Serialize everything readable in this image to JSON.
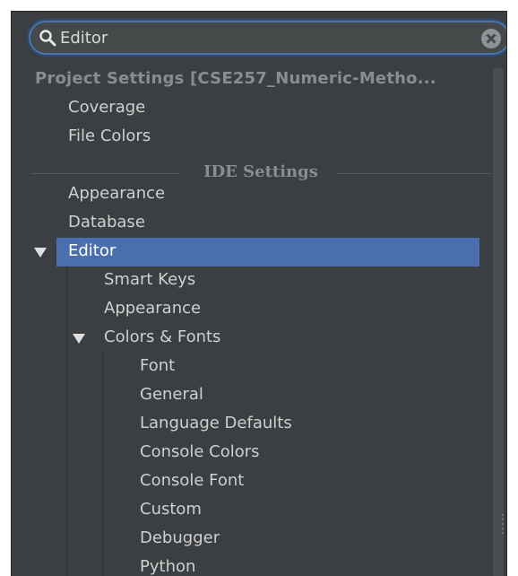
{
  "search": {
    "value": "Editor"
  },
  "project_settings": {
    "header": "Project Settings [CSE257_Numeric-Metho...",
    "items": [
      "Coverage",
      "File Colors"
    ]
  },
  "ide_settings": {
    "header": "IDE Settings",
    "items": [
      "Appearance",
      "Database"
    ]
  },
  "editor": {
    "label": "Editor",
    "children": [
      "Smart Keys",
      "Appearance"
    ],
    "colors_fonts": {
      "label": "Colors & Fonts",
      "children": [
        "Font",
        "General",
        "Language Defaults",
        "Console Colors",
        "Console Font",
        "Custom",
        "Debugger",
        "Python"
      ]
    }
  },
  "colors": {
    "selection": "#4b6eaf",
    "background": "#3c3f41",
    "search_border": "#4b74a8"
  },
  "icons": [
    "search-icon",
    "clear-icon",
    "expand-arrow-icon"
  ]
}
